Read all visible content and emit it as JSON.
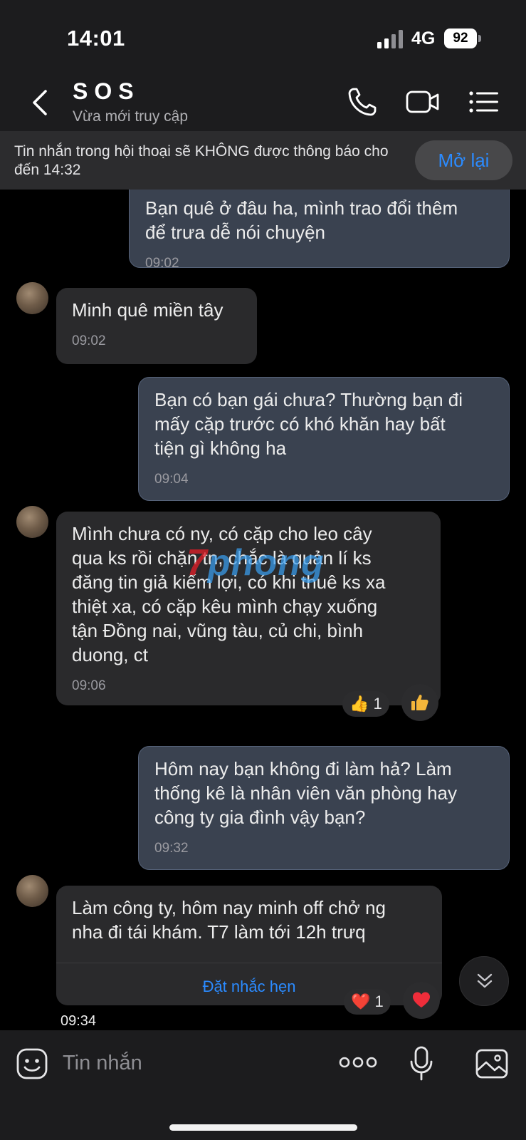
{
  "status_bar": {
    "time": "14:01",
    "network": "4G",
    "battery": "92"
  },
  "header": {
    "title": "SOS",
    "subtitle": "Vừa mới truy cập"
  },
  "banner": {
    "text": "Tin nhắn trong hội thoại sẽ KHÔNG được thông báo cho đến 14:32",
    "button": "Mở lại"
  },
  "messages": [
    {
      "side": "out",
      "text": "Bạn quê ở đâu ha, mình trao đổi thêm\nđể trưa dễ nói chuyện",
      "time": "09:02"
    },
    {
      "side": "in",
      "text": "Minh quê miền tây",
      "time": "09:02"
    },
    {
      "side": "out",
      "text": "Bạn có bạn gái chưa? Thường bạn đi\nmấy cặp trước có khó khăn hay bất\ntiện gì không ha",
      "time": "09:04"
    },
    {
      "side": "in",
      "text": "Mình chưa có ny, có cặp cho leo cây\nqua ks rồi chặn tn, chắc là quản lí ks\nđăng tin giả kiếm lợi, có khi thuê ks xa\nthiệt xa, có cặp kêu mình chạy xuống\ntận Đồng nai, vũng tàu, củ chi, bình\nduong, ct",
      "time": "09:06",
      "reaction": {
        "emoji": "👍",
        "count": "1"
      }
    },
    {
      "side": "out",
      "text": "Hôm nay bạn không đi làm hả? Làm\nthống kê là nhân viên văn phòng hay\ncông ty gia đình vậy bạn?",
      "time": "09:32"
    },
    {
      "side": "in",
      "text": "Làm công ty, hôm nay minh off chở ng\nnha đi tái khám. T7 làm tới 12h trưq",
      "time": "09:34",
      "reminder": "Đặt nhắc hẹn",
      "reaction": {
        "emoji": "❤️",
        "count": "1"
      }
    }
  ],
  "watermark": {
    "first": "7",
    "rest": "phong"
  },
  "composer": {
    "placeholder": "Tin nhắn"
  },
  "icons": [
    "back-chevron-icon",
    "phone-icon",
    "video-camera-icon",
    "list-menu-icon",
    "thumbs-up-icon",
    "heart-icon",
    "double-chevron-down-icon",
    "sticker-smile-icon",
    "more-dots-icon",
    "microphone-icon",
    "image-icon"
  ],
  "colors": {
    "accent": "#2b8bff",
    "outgoing_bubble": "#3a4250",
    "incoming_bubble": "#2a2a2c",
    "background": "#000000",
    "bar": "#1c1c1e"
  }
}
